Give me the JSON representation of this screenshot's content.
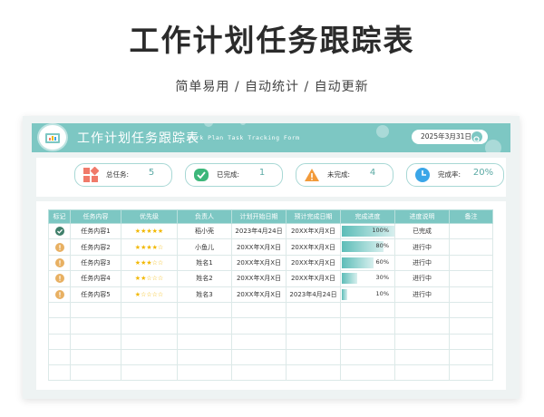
{
  "page": {
    "title": "工作计划任务跟踪表",
    "subtitle": "简单易用  /  自动统计  /  自动更新"
  },
  "banner": {
    "title": "工作计划任务跟踪表",
    "subtitle": "Work Plan Task Tracking Form",
    "date": "2025年3月31日"
  },
  "stats": [
    {
      "label": "总任务:",
      "value": "5",
      "icon": "grid-icon",
      "color": "#f07a6a"
    },
    {
      "label": "已完成:",
      "value": "1",
      "icon": "check-icon",
      "color": "#3db77a"
    },
    {
      "label": "未完成:",
      "value": "4",
      "icon": "warning-icon",
      "color": "#f29a3a"
    },
    {
      "label": "完成率:",
      "value": "20%",
      "icon": "clock-icon",
      "color": "#3ba6e8"
    }
  ],
  "table": {
    "headers": [
      "标记",
      "任务内容",
      "优先级",
      "负责人",
      "计划开始日期",
      "预计完成日期",
      "完成进度",
      "进度说明",
      "备注"
    ],
    "rows": [
      {
        "mark": "check",
        "task": "任务内容1",
        "priority": "★★★★★",
        "owner": "稻小壳",
        "start": "2023年4月24日",
        "end": "20XX年X月X日",
        "progress": 100,
        "progress_label": "100%",
        "status": "已完成",
        "note": ""
      },
      {
        "mark": "alert",
        "task": "任务内容2",
        "priority": "★★★★☆",
        "owner": "小鱼儿",
        "start": "20XX年X月X日",
        "end": "20XX年X月X日",
        "progress": 80,
        "progress_label": "80%",
        "status": "进行中",
        "note": ""
      },
      {
        "mark": "alert",
        "task": "任务内容3",
        "priority": "★★★☆☆",
        "owner": "姓名1",
        "start": "20XX年X月X日",
        "end": "20XX年X月X日",
        "progress": 60,
        "progress_label": "60%",
        "status": "进行中",
        "note": ""
      },
      {
        "mark": "alert",
        "task": "任务内容4",
        "priority": "★★☆☆☆",
        "owner": "姓名2",
        "start": "20XX年X月X日",
        "end": "20XX年X月X日",
        "progress": 30,
        "progress_label": "30%",
        "status": "进行中",
        "note": ""
      },
      {
        "mark": "alert",
        "task": "任务内容5",
        "priority": "★☆☆☆☆",
        "owner": "姓名3",
        "start": "20XX年X月X日",
        "end": "2023年4月24日",
        "progress": 10,
        "progress_label": "10%",
        "status": "进行中",
        "note": ""
      }
    ],
    "empty_rows": 5
  },
  "colors": {
    "accent": "#7dc7c3",
    "mark_done": "#3f7f6a",
    "mark_pending": "#e8b062"
  }
}
